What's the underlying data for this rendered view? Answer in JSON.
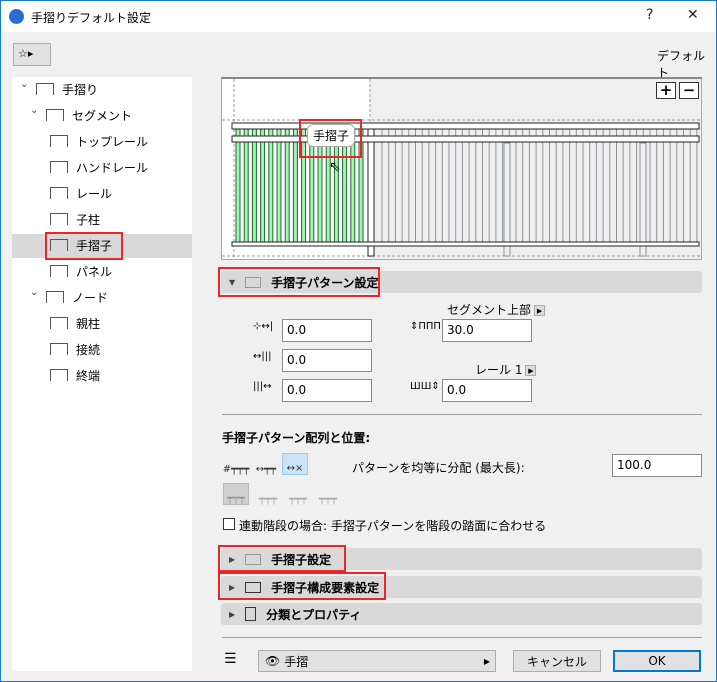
{
  "window": {
    "title": "手摺りデフォルト設定",
    "help": "?",
    "close": "✕"
  },
  "header": {
    "default_label": "デフォルト"
  },
  "tree": [
    {
      "label": "手摺り",
      "level": 0
    },
    {
      "label": "セグメント",
      "level": 1
    },
    {
      "label": "トップレール",
      "level": 2
    },
    {
      "label": "ハンドレール",
      "level": 2
    },
    {
      "label": "レール",
      "level": 2
    },
    {
      "label": "子柱",
      "level": 2
    },
    {
      "label": "手摺子",
      "level": 2,
      "selected": true
    },
    {
      "label": "パネル",
      "level": 2
    },
    {
      "label": "ノード",
      "level": 1
    },
    {
      "label": "親柱",
      "level": 2
    },
    {
      "label": "接続",
      "level": 2
    },
    {
      "label": "終端",
      "level": 2
    }
  ],
  "preview": {
    "tooltip": "手摺子",
    "zoom_in": "+",
    "zoom_out": "−",
    "highlight_color": "#a8f0b8",
    "outline_color": "#1a6b2a"
  },
  "pattern_panel": {
    "title": "手摺子パターン設定",
    "left_offset": "0.0",
    "start_offset": "0.0",
    "end_offset": "0.0",
    "segment_top_label": "セグメント上部",
    "segment_top_value": "30.0",
    "rail_label": "レール 1",
    "rail_value": "0.0"
  },
  "arrangement": {
    "heading": "手摺子パターン配列と位置:",
    "distribute_label": "パターンを均等に分配 (最大長):",
    "distribute_value": "100.0",
    "stair_checkbox_label": "連動階段の場合: 手摺子パターンを階段の踏面に合わせる",
    "stair_checked": false
  },
  "panels": [
    {
      "label": "手摺子設定"
    },
    {
      "label": "手摺子構成要素設定"
    },
    {
      "label": "分類とプロパティ"
    }
  ],
  "footer": {
    "layer": "手摺",
    "cancel": "キャンセル",
    "ok": "OK"
  }
}
